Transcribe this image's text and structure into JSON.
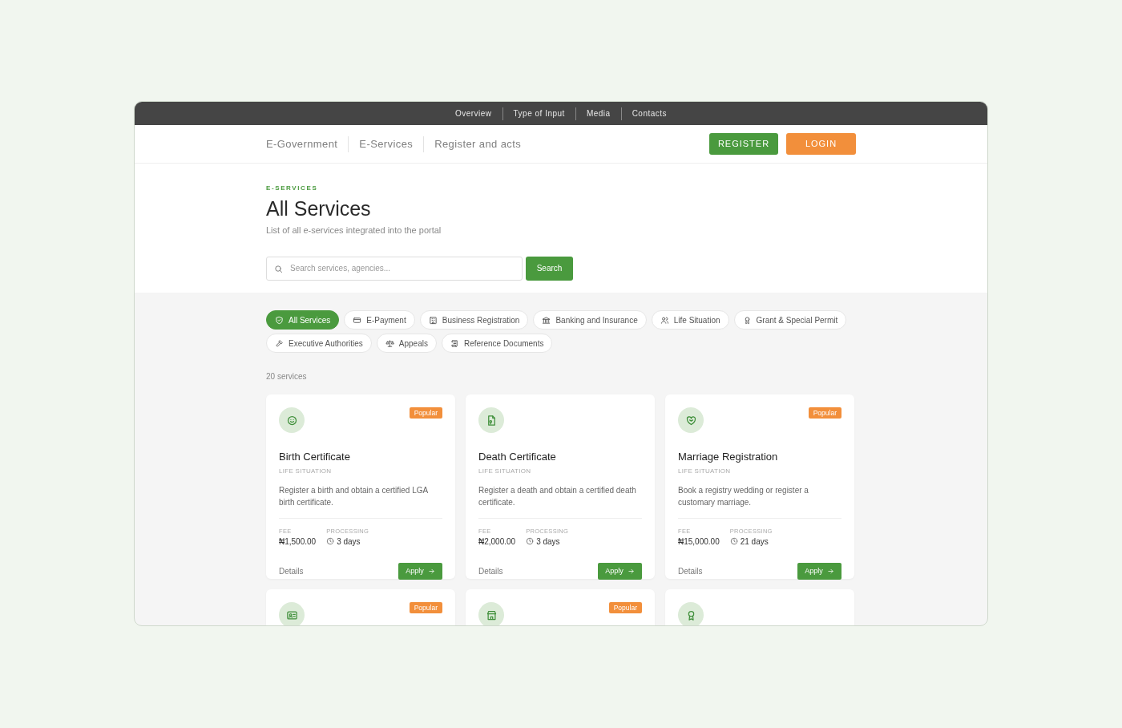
{
  "top_nav": [
    "Overview",
    "Type of Input",
    "Media",
    "Contacts"
  ],
  "header": {
    "links": [
      "E-Government",
      "E-Services",
      "Register and acts"
    ],
    "register": "REGISTER",
    "login": "LOGIN"
  },
  "hero": {
    "eyebrow": "E-SERVICES",
    "title": "All Services",
    "subtitle": "List of all e-services integrated into the portal",
    "search": {
      "placeholder": "Search services, agencies...",
      "button": "Search"
    }
  },
  "filters": [
    {
      "label": "All Services",
      "selected": true
    },
    {
      "label": "E-Payment",
      "selected": false
    },
    {
      "label": "Business Registration",
      "selected": false
    },
    {
      "label": "Banking and Insurance",
      "selected": false
    },
    {
      "label": "Life Situation",
      "selected": false
    },
    {
      "label": "Grant & Special Permit",
      "selected": false
    },
    {
      "label": "Executive Authorities",
      "selected": false
    },
    {
      "label": "Appeals",
      "selected": false
    },
    {
      "label": "Reference Documents",
      "selected": false
    }
  ],
  "count": "20 services",
  "cards": [
    {
      "popular": true,
      "badge": "Popular",
      "title": "Birth Certificate",
      "category": "LIFE SITUATION",
      "description": "Register a birth and obtain a certified LGA birth certificate.",
      "fee_label": "FEE",
      "fee": "₦1,500.00",
      "processing_label": "PROCESSING",
      "processing": "3 days",
      "details": "Details",
      "apply": "Apply"
    },
    {
      "popular": false,
      "title": "Death Certificate",
      "category": "LIFE SITUATION",
      "description": "Register a death and obtain a certified death certificate.",
      "fee_label": "FEE",
      "fee": "₦2,000.00",
      "processing_label": "PROCESSING",
      "processing": "3 days",
      "details": "Details",
      "apply": "Apply"
    },
    {
      "popular": true,
      "badge": "Popular",
      "title": "Marriage Registration",
      "category": "LIFE SITUATION",
      "description": "Book a registry wedding or register a customary marriage.",
      "fee_label": "FEE",
      "fee": "₦15,000.00",
      "processing_label": "PROCESSING",
      "processing": "21 days",
      "details": "Details",
      "apply": "Apply"
    },
    {
      "popular": true,
      "badge": "Popular"
    },
    {
      "popular": true,
      "badge": "Popular"
    },
    {
      "popular": false
    }
  ]
}
